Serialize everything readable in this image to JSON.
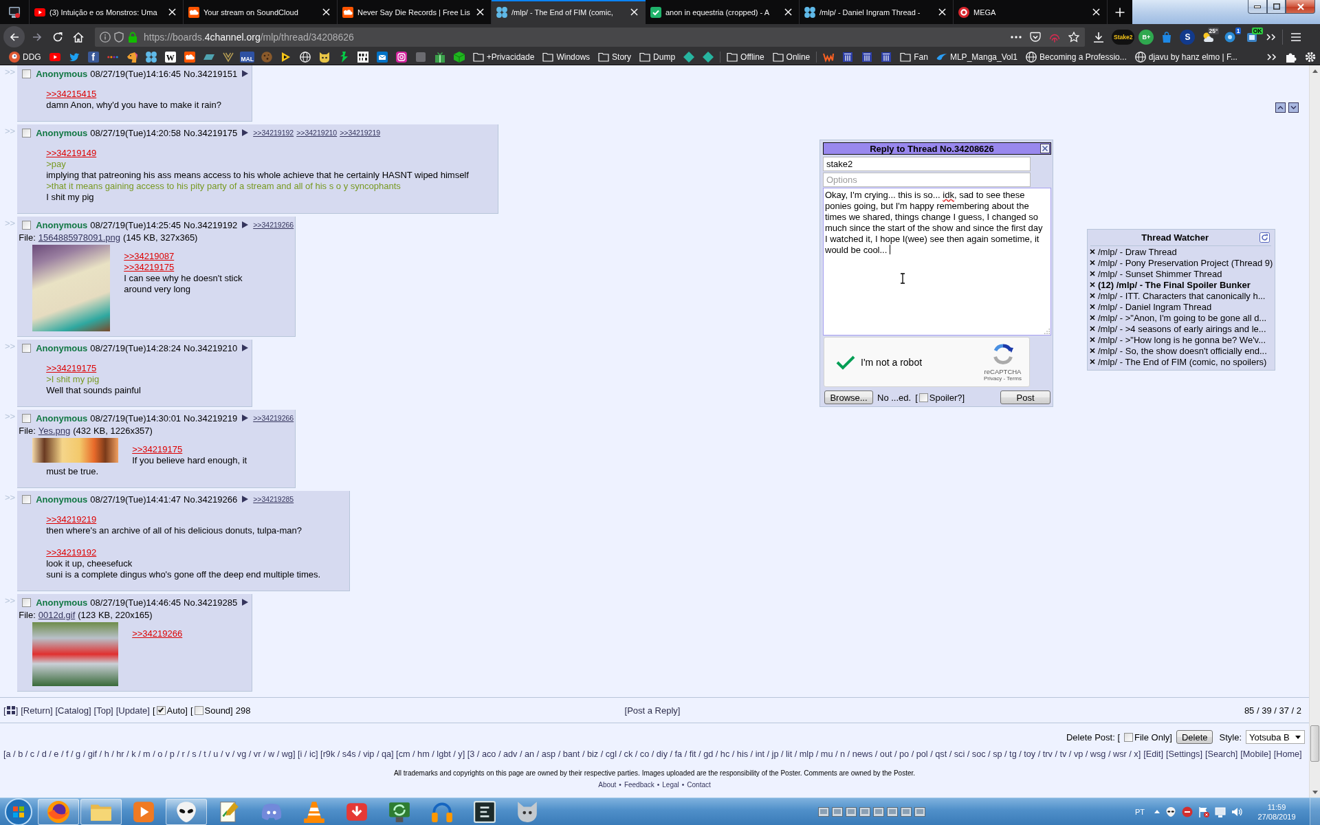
{
  "browser": {
    "tabs": [
      {
        "kind": "pinned",
        "selected": false
      },
      {
        "kind": "tab",
        "label": "(3) Intuição e os Monstros: Uma",
        "selected": false
      },
      {
        "kind": "tab",
        "label": "Your stream on SoundCloud",
        "selected": false
      },
      {
        "kind": "tab",
        "label": "Never Say Die Records | Free Lis",
        "selected": false
      },
      {
        "kind": "tab",
        "label": "/mlp/ - The End of FIM (comic,",
        "selected": true
      },
      {
        "kind": "tab",
        "label": "anon in equestria (cropped) - A",
        "selected": false
      },
      {
        "kind": "tab",
        "label": "/mlp/ - Daniel Ingram Thread -",
        "selected": false
      },
      {
        "kind": "tab",
        "label": "MEGA",
        "selected": false
      }
    ],
    "url": {
      "host_prefix": "https://boards.",
      "domain": "4channel.org",
      "path": "/mlp/thread/34208626"
    },
    "extensions": [
      {
        "kind": "icon"
      },
      {
        "kind": "logo",
        "label": "Stake2"
      },
      {
        "kind": "logo",
        "label": "B+"
      },
      {
        "kind": "icon"
      },
      {
        "kind": "logo",
        "label": "S"
      },
      {
        "kind": "badge",
        "label": "25°"
      },
      {
        "kind": "badge",
        "label": "1"
      },
      {
        "kind": "badge",
        "label": "OK"
      }
    ],
    "bookmarks": [
      {
        "kind": "site",
        "label": "DDG"
      },
      {
        "kind": "icon"
      },
      {
        "kind": "icon"
      },
      {
        "kind": "icon",
        "glyph": "f"
      },
      {
        "kind": "icon"
      },
      {
        "kind": "icon"
      },
      {
        "kind": "icon"
      },
      {
        "kind": "icon",
        "glyph": "W"
      },
      {
        "kind": "icon"
      },
      {
        "kind": "icon"
      },
      {
        "kind": "icon"
      },
      {
        "kind": "icon",
        "glyph": "MAL"
      },
      {
        "kind": "icon"
      },
      {
        "kind": "icon"
      },
      {
        "kind": "icon"
      },
      {
        "kind": "icon"
      },
      {
        "kind": "icon"
      },
      {
        "kind": "icon"
      },
      {
        "kind": "icon"
      },
      {
        "kind": "icon"
      },
      {
        "kind": "icon"
      },
      {
        "kind": "icon"
      },
      {
        "kind": "icon"
      },
      {
        "kind": "folder",
        "label": "+Privacidade"
      },
      {
        "kind": "folder",
        "label": "Windows"
      },
      {
        "kind": "folder",
        "label": "Story"
      },
      {
        "kind": "folder",
        "label": "Dump"
      },
      {
        "kind": "icon"
      },
      {
        "kind": "icon"
      },
      {
        "kind": "separator"
      },
      {
        "kind": "folder",
        "label": "Offline"
      },
      {
        "kind": "folder",
        "label": "Online"
      },
      {
        "kind": "separator"
      },
      {
        "kind": "icon"
      },
      {
        "kind": "icon"
      },
      {
        "kind": "icon"
      },
      {
        "kind": "icon"
      },
      {
        "kind": "folder",
        "label": "Fan"
      },
      {
        "kind": "site",
        "label": "MLP_Manga_Vol1"
      },
      {
        "kind": "site",
        "label": "Becoming a Professio..."
      },
      {
        "kind": "site",
        "label": "djavu by hanz elmo | F..."
      }
    ]
  },
  "posts": [
    {
      "side": ">>",
      "checked": false,
      "name": "Anonymous",
      "datetime": "08/27/19(Tue)14:16:45",
      "number": "No.34219151",
      "lines": [
        {
          "kind": "quote",
          "text": ">>34215415"
        },
        {
          "kind": "text",
          "text": "damn Anon, why'd you have to make it rain?"
        }
      ]
    },
    {
      "side": ">>",
      "checked": false,
      "name": "Anonymous",
      "datetime": "08/27/19(Tue)14:20:58",
      "number": "No.34219175",
      "backlinks": [
        ">>34219192",
        ">>34219210",
        ">>34219219"
      ],
      "lines": [
        {
          "kind": "quote",
          "text": ">>34219149"
        },
        {
          "kind": "green",
          "text": ">pay"
        },
        {
          "kind": "text",
          "text": "implying that patreoning his ass means access to his whole achieve that he certainly HASNT wiped himself"
        },
        {
          "kind": "green",
          "text": ">that it means gaining access to his pity party of a stream and all of his s o y syncophants"
        },
        {
          "kind": "text",
          "text": "I shit my pig"
        }
      ]
    },
    {
      "side": ">>",
      "checked": false,
      "name": "Anonymous",
      "datetime": "08/27/19(Tue)14:25:45",
      "number": "No.34219192",
      "backlinks": [
        ">>34219266"
      ],
      "file": {
        "label": "File:",
        "name": "1564885978091.png",
        "info": "(145 KB, 327x365)"
      },
      "lines": [
        {
          "kind": "quote",
          "text": ">>34219087"
        },
        {
          "kind": "quote",
          "text": ">>34219175"
        },
        {
          "kind": "text",
          "text": "I can see why he doesn't stick around very long"
        }
      ]
    },
    {
      "side": ">>",
      "checked": false,
      "name": "Anonymous",
      "datetime": "08/27/19(Tue)14:28:24",
      "number": "No.34219210",
      "lines": [
        {
          "kind": "quote",
          "text": ">>34219175"
        },
        {
          "kind": "green",
          "text": ">I shit my pig"
        },
        {
          "kind": "text",
          "text": "Well that sounds painful"
        }
      ]
    },
    {
      "side": ">>",
      "checked": false,
      "name": "Anonymous",
      "datetime": "08/27/19(Tue)14:30:01",
      "number": "No.34219219",
      "backlinks": [
        ">>34219266"
      ],
      "file": {
        "label": "File:",
        "name": "Yes.png",
        "info": "(432 KB, 1226x357)"
      },
      "lines": [
        {
          "kind": "quote",
          "text": ">>34219175"
        },
        {
          "kind": "text",
          "text": "If you believe hard enough, it must be true."
        }
      ]
    },
    {
      "side": ">>",
      "checked": false,
      "name": "Anonymous",
      "datetime": "08/27/19(Tue)14:41:47",
      "number": "No.34219266",
      "backlinks": [
        ">>34219285"
      ],
      "lines": [
        {
          "kind": "quote",
          "text": ">>34219219"
        },
        {
          "kind": "text",
          "text": "then where's an archive of all of his delicious donuts, tulpa-man?"
        },
        {
          "kind": "blank"
        },
        {
          "kind": "quote",
          "text": ">>34219192"
        },
        {
          "kind": "text",
          "text": "look it up, cheesefuck"
        },
        {
          "kind": "text",
          "text": "suni is a complete dingus who's gone off the deep end multiple times."
        }
      ]
    },
    {
      "side": ">>",
      "checked": false,
      "name": "Anonymous",
      "datetime": "08/27/19(Tue)14:46:45",
      "number": "No.34219285",
      "file": {
        "label": "File:",
        "name": "0012d.gif",
        "info": "(123 KB, 220x165)"
      },
      "lines": [
        {
          "kind": "quote",
          "text": ">>34219266"
        }
      ]
    }
  ],
  "reply_form": {
    "title": "Reply to Thread No.34208626",
    "name_value": "stake2",
    "options_placeholder": "Options",
    "comment": [
      {
        "text": "Okay, I'm crying... this is so... ",
        "misspelled": false
      },
      {
        "text": "idk",
        "misspelled": true
      },
      {
        "text": ", sad to see these ponies going, but I'm happy remembering about the times we shared, things change I guess, I changed so much since the start of the show and since the first day I watched it, I hope I(wee) see then again sometime, it would be cool... ",
        "misspelled": false
      }
    ],
    "captcha": {
      "label": "I'm not a robot",
      "checked": true,
      "brand": "reCAPTCHA",
      "links": "Privacy - Terms"
    },
    "browse": "Browse...",
    "file_status": "No ...ed.",
    "spoiler": {
      "before": "[",
      "label": "Spoiler?]",
      "checked": false
    },
    "submit": "Post"
  },
  "thread_watcher": {
    "title": "Thread Watcher",
    "threads": [
      {
        "label": "/mlp/ - Draw Thread",
        "unread": false
      },
      {
        "label": "/mlp/ - Pony Preservation Project (Thread 9)",
        "unread": false
      },
      {
        "label": "/mlp/ - Sunset Shimmer Thread",
        "unread": false
      },
      {
        "label": "(12) /mlp/ - The Final Spoiler Bunker",
        "unread": true
      },
      {
        "label": "/mlp/ - ITT. Characters that canonically h...",
        "unread": false
      },
      {
        "label": "/mlp/ - Daniel Ingram Thread",
        "unread": false
      },
      {
        "label": "/mlp/ - >\"Anon, I'm going to be gone all d...",
        "unread": false
      },
      {
        "label": "/mlp/ - >4 seasons of early airings and le...",
        "unread": false
      },
      {
        "label": "/mlp/ - >\"How long is he gonna be? We'v...",
        "unread": false
      },
      {
        "label": "/mlp/ - So, the show doesn't officially end...",
        "unread": false
      },
      {
        "label": "/mlp/ - The End of FIM (comic, no spoilers)",
        "unread": false
      }
    ]
  },
  "thread_nav": {
    "links": [
      {
        "kind": "icon",
        "before": "[",
        "after": "]"
      },
      {
        "kind": "link",
        "label": "[Return]"
      },
      {
        "kind": "link",
        "label": "[Catalog]"
      },
      {
        "kind": "link",
        "label": "[Top]"
      },
      {
        "kind": "link",
        "label": "[Update]"
      },
      {
        "kind": "check",
        "before": "[",
        "label": "Auto]",
        "checked": true
      },
      {
        "kind": "check",
        "before": "[",
        "label": "Sound]",
        "checked": false
      },
      {
        "kind": "text",
        "label": "298"
      }
    ],
    "post_reply": "[Post a Reply]",
    "stats": "85 / 39 / 37 / 2"
  },
  "delete_form": {
    "label": "Delete Post: [",
    "file_only": {
      "label": "File Only]",
      "checked": false
    },
    "button": "Delete",
    "style_label": "Style:",
    "style_value": "Yotsuba B"
  },
  "board_list": {
    "boards": "[a / b / c / d / e / f / g / gif / h / hr / k / m / o / p / r / s / t / u / v / vg / vr / w / wg] [i / ic] [r9k / s4s / vip / qa] [cm / hm / lgbt / y] [3 / aco / adv / an / asp / bant / biz / cgl / ck / co / diy / fa / fit / gd / hc / his / int / jp / lit / mlp / mu / n / news / out / po / pol / qst / sci / soc / sp / tg / toy / trv / tv / vp / wsg / wsr / x]",
    "links": [
      "[Edit]",
      "[Settings]",
      "[Search]",
      "[Mobile]",
      "[Home]"
    ]
  },
  "footer": {
    "disclaimer": "All trademarks and copyrights on this page are owned by their respective parties. Images uploaded are the responsibility of the Poster. Comments are owned by the Poster.",
    "links": [
      "About",
      "Feedback",
      "Legal",
      "Contact"
    ],
    "separator": "•"
  },
  "taskbar": {
    "apps": [
      {
        "running": true
      },
      {
        "running": true
      },
      {
        "running": false
      },
      {
        "running": true
      },
      {
        "running": false
      },
      {
        "running": false
      },
      {
        "running": false
      },
      {
        "running": false
      },
      {
        "running": false
      },
      {
        "running": false
      },
      {
        "running": false
      },
      {
        "running": false
      }
    ],
    "language": "PT",
    "time": "11:59",
    "date": "27/08/2019"
  }
}
